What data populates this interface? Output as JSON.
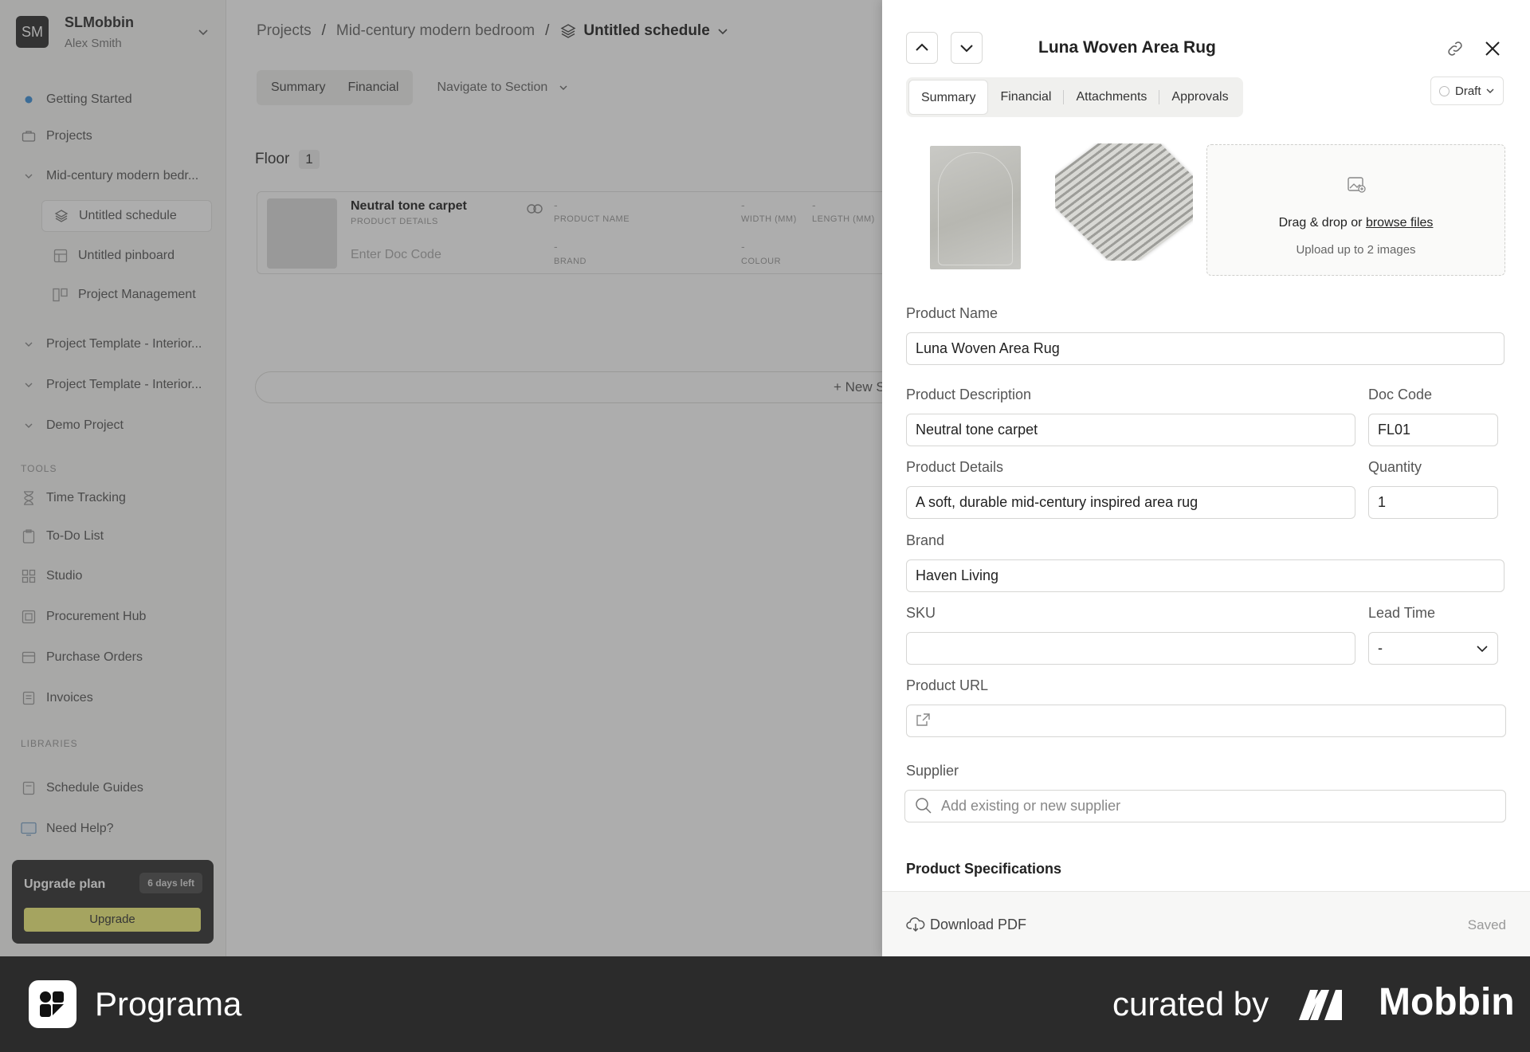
{
  "workspace": {
    "initials": "SM",
    "name": "SLMobbin",
    "user": "Alex Smith"
  },
  "sidebar": {
    "getting_started": "Getting Started",
    "projects": "Projects",
    "project_current": "Mid-century modern bedr...",
    "sub_items": [
      "Untitled schedule",
      "Untitled pinboard",
      "Project Management"
    ],
    "other_projects": [
      "Project Template - Interior...",
      "Project Template - Interior...",
      "Demo Project"
    ],
    "tools_heading": "TOOLS",
    "tools": [
      "Time Tracking",
      "To-Do List",
      "Studio",
      "Procurement Hub",
      "Purchase Orders",
      "Invoices"
    ],
    "libraries_heading": "LIBRARIES",
    "libraries": [
      "Schedule Guides",
      "Need Help?"
    ],
    "upgrade": {
      "title": "Upgrade plan",
      "badge": "6 days left",
      "button": "Upgrade"
    }
  },
  "breadcrumb": {
    "projects": "Projects",
    "project": "Mid-century modern bedroom",
    "schedule": "Untitled schedule"
  },
  "main": {
    "tabs": [
      "Summary",
      "Financial"
    ],
    "navigate": "Navigate to Section",
    "section": {
      "name": "Floor",
      "count": "1"
    },
    "row": {
      "title": "Neutral tone carpet",
      "sub": "PRODUCT DETAILS",
      "doc_code_placeholder": "Enter Doc Code",
      "dash": "-",
      "product_name_lbl": "PRODUCT NAME",
      "width_lbl": "WIDTH (MM)",
      "length_lbl": "LENGTH (MM)",
      "brand_lbl": "BRAND",
      "colour_lbl": "COLOUR"
    },
    "new_section": "+ New S"
  },
  "panel": {
    "title": "Luna Woven Area Rug",
    "tabs": [
      "Summary",
      "Financial",
      "Attachments",
      "Approvals"
    ],
    "status": "Draft",
    "upload": {
      "text": "Drag & drop or ",
      "link": "browse files",
      "hint": "Upload up to 2 images"
    },
    "fields": {
      "product_name": {
        "label": "Product Name",
        "value": "Luna Woven Area Rug"
      },
      "product_description": {
        "label": "Product Description",
        "value": "Neutral tone carpet"
      },
      "doc_code": {
        "label": "Doc Code",
        "value": "FL01"
      },
      "product_details": {
        "label": "Product Details",
        "value": "A soft, durable mid-century inspired area rug"
      },
      "quantity": {
        "label": "Quantity",
        "value": "1"
      },
      "brand": {
        "label": "Brand",
        "value": "Haven Living"
      },
      "sku": {
        "label": "SKU",
        "value": ""
      },
      "lead_time": {
        "label": "Lead Time",
        "value": "-"
      },
      "product_url": {
        "label": "Product URL",
        "value": ""
      },
      "supplier": {
        "label": "Supplier",
        "placeholder": "Add existing or new supplier"
      }
    },
    "specs_heading": "Product Specifications",
    "download": "Download PDF",
    "saved": "Saved"
  },
  "footer": {
    "brand": "Programa",
    "curated": "curated by",
    "mobbin": "Mobbin"
  }
}
